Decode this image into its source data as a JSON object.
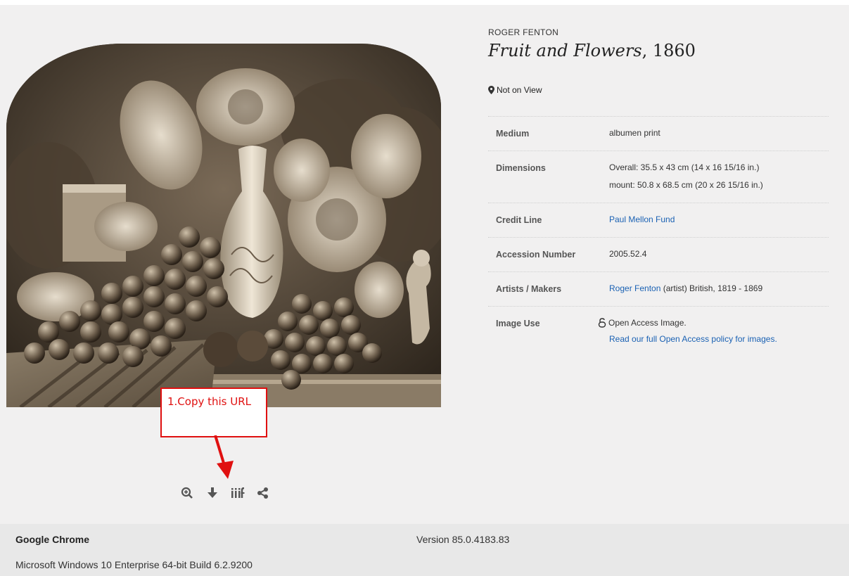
{
  "artwork": {
    "artist": "ROGER FENTON",
    "title": "Fruit and Flowers",
    "date": ", 1860",
    "location": "Not on View",
    "image_alt": "Fruit and Flowers photograph"
  },
  "annotation": {
    "callout_text": "1.Copy this URL",
    "callout_color": "#e01010"
  },
  "toolbar": {
    "tools": [
      "zoom-icon",
      "download-icon",
      "iiif-icon",
      "share-icon"
    ],
    "iiif_label": "iiif"
  },
  "details": {
    "rows": [
      {
        "label": "Medium",
        "values": [
          "albumen print"
        ]
      },
      {
        "label": "Dimensions",
        "values": [
          "Overall: 35.5 x 43 cm (14 x 16 15/16 in.)",
          "mount: 50.8 x 68.5 cm (20 x 26 15/16 in.)"
        ]
      },
      {
        "label": "Credit Line",
        "link": "Paul Mellon Fund"
      },
      {
        "label": "Accession Number",
        "values": [
          "2005.52.4"
        ]
      },
      {
        "label": "Artists / Makers",
        "link": "Roger Fenton",
        "suffix": " (artist) British, 1819 - 1869"
      },
      {
        "label": "Image Use",
        "values": [
          "Open Access Image."
        ],
        "link": "Read our full Open Access policy for images."
      }
    ],
    "link_color": "#1a61b3"
  },
  "footer": {
    "browser": "Google Chrome",
    "version": "Version 85.0.4183.83",
    "os": "Microsoft Windows 10 Enterprise 64-bit Build 6.2.9200"
  }
}
